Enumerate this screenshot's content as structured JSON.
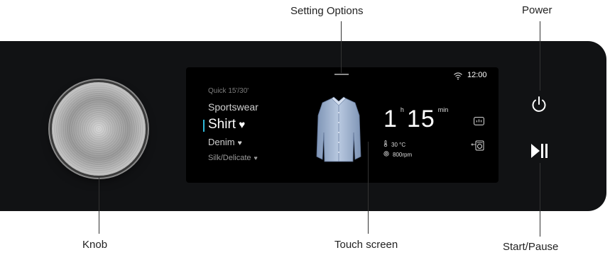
{
  "callouts": {
    "setting_options": "Setting Options",
    "power": "Power",
    "knob": "Knob",
    "touch_screen": "Touch screen",
    "start_pause": "Start/Pause"
  },
  "screen": {
    "clock": "12:00",
    "programs": [
      "Quick 15'/30'",
      "Sportswear",
      "Shirt",
      "Denim",
      "Silk/Delicate"
    ],
    "selected_program": "Shirt",
    "time_hours": "1",
    "time_hours_unit": "h",
    "time_minutes": "15",
    "time_minutes_unit": "min",
    "temperature": "30 °C",
    "spin": "800rpm",
    "icons": [
      "wifi-icon",
      "temperature-icon",
      "spin-icon",
      "stats-icon",
      "drum-settings-icon",
      "heart-icon"
    ]
  },
  "colors": {
    "panel": "#111214",
    "screen": "#000000",
    "accent": "#2fb9d9"
  }
}
